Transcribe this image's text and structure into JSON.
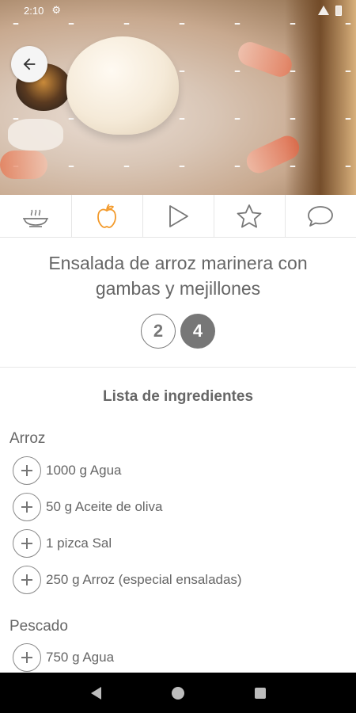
{
  "status_bar": {
    "time": "2:10"
  },
  "hero": {
    "image_name": "ensalada-arroz-photo"
  },
  "tabs": [
    {
      "name": "cooking-tab",
      "icon": "pot-steam-icon"
    },
    {
      "name": "ingredients-tab",
      "icon": "apple-icon",
      "active": true
    },
    {
      "name": "play-tab",
      "icon": "play-icon"
    },
    {
      "name": "favorite-tab",
      "icon": "star-icon"
    },
    {
      "name": "comments-tab",
      "icon": "chat-bubble-icon"
    }
  ],
  "recipe": {
    "title": "Ensalada de arroz marinera con gambas y mejillones",
    "servings": [
      {
        "label": "2",
        "selected": false
      },
      {
        "label": "4",
        "selected": true
      }
    ]
  },
  "ingredients": {
    "list_title": "Lista de ingredientes",
    "sections": [
      {
        "heading": "Arroz",
        "items": [
          "1000 g Agua",
          "50 g Aceite de oliva",
          "1 pizca Sal",
          "250 g Arroz (especial ensaladas)"
        ]
      },
      {
        "heading": "Pescado",
        "items": [
          "750 g Agua"
        ]
      }
    ]
  },
  "colors": {
    "accent": "#f39a2b",
    "text": "#666666",
    "icon_gray": "#777777"
  }
}
